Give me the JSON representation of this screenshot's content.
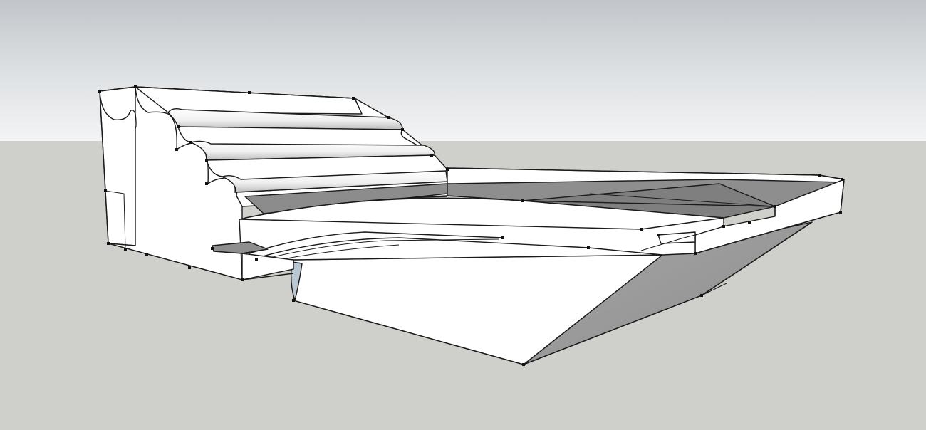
{
  "viewport": {
    "sky_color_top": "#c2c6ca",
    "sky_color_bottom": "#f3f4f5",
    "ground_color": "#cfcfcb",
    "face_color": "#ffffff",
    "shaded_face_color": "#8c8c8c",
    "edge_color": "#1a1a1a"
  },
  "scene": {
    "model": "3d-stepped-curved-structure"
  }
}
